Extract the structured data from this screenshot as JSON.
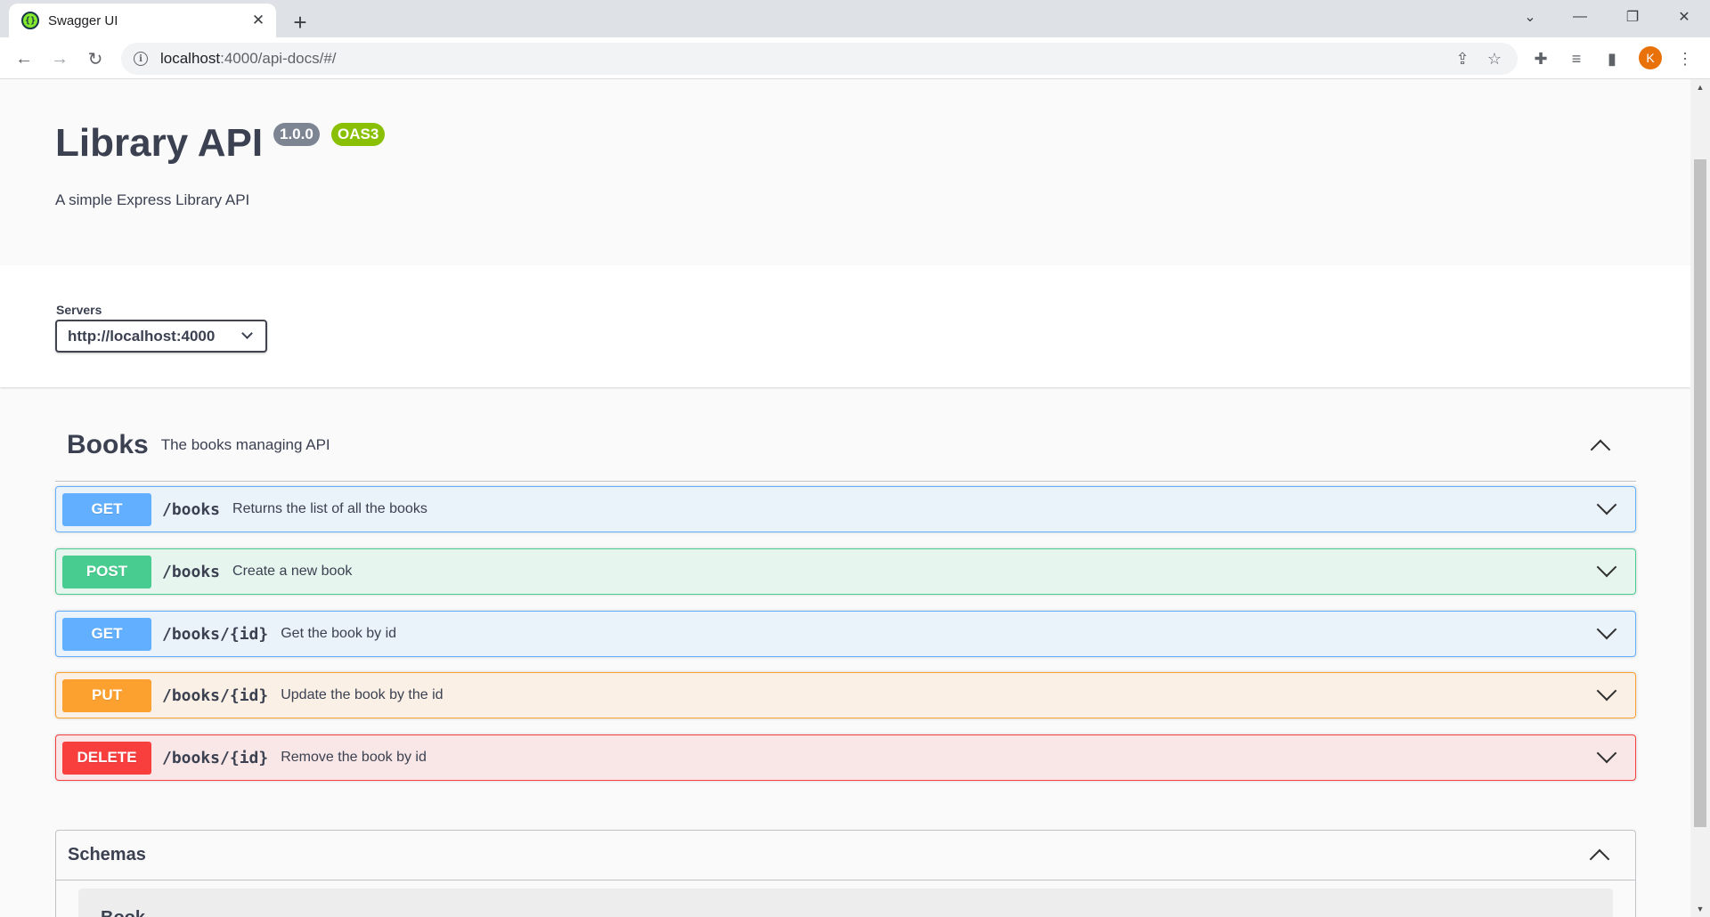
{
  "browser": {
    "tab_title": "Swagger UI",
    "tab_favicon": "swagger-logo-icon",
    "url_host": "localhost",
    "url_rest": ":4000/api-docs/#/",
    "profile_initial": "K"
  },
  "info": {
    "title": "Library API",
    "version": "1.0.0",
    "oas": "OAS3",
    "description": "A simple Express Library API"
  },
  "servers": {
    "label": "Servers",
    "selected": "http://localhost:4000"
  },
  "tag": {
    "name": "Books",
    "description": "The books managing API"
  },
  "operations": [
    {
      "method": "GET",
      "path": "/books",
      "summary": "Returns the list of all the books",
      "color": "#61affe"
    },
    {
      "method": "POST",
      "path": "/books",
      "summary": "Create a new book",
      "color": "#49cc90"
    },
    {
      "method": "GET",
      "path": "/books/{id}",
      "summary": "Get the book by id",
      "color": "#61affe"
    },
    {
      "method": "PUT",
      "path": "/books/{id}",
      "summary": "Update the book by the id",
      "color": "#fca130"
    },
    {
      "method": "DELETE",
      "path": "/books/{id}",
      "summary": "Remove the book by id",
      "color": "#f93e3e"
    }
  ],
  "schemas": {
    "title": "Schemas",
    "models": [
      "Book"
    ]
  }
}
